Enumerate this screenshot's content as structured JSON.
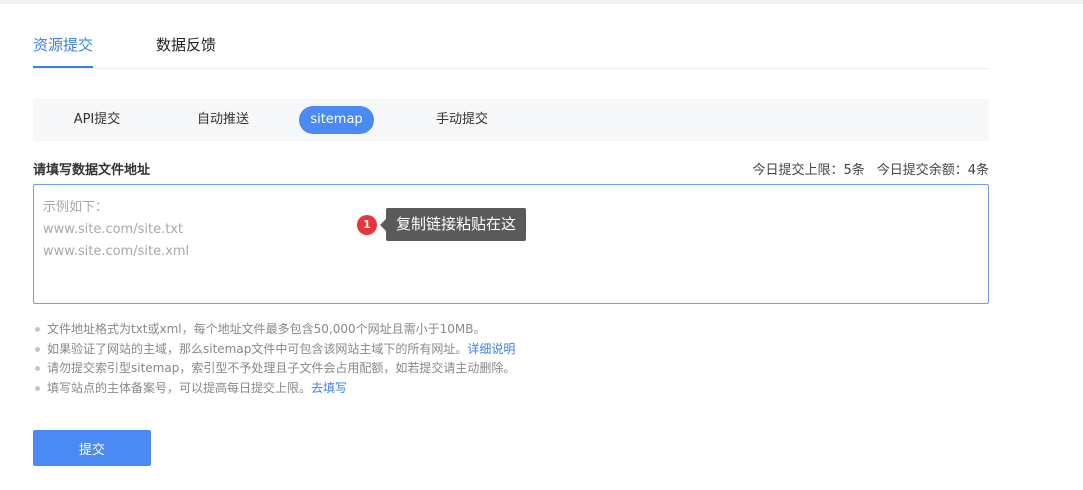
{
  "tabs": [
    {
      "label": "资源提交",
      "active": true
    },
    {
      "label": "数据反馈",
      "active": false
    }
  ],
  "subtabs": [
    {
      "label": "API提交",
      "active": false
    },
    {
      "label": "自动推送",
      "active": false
    },
    {
      "label": "sitemap",
      "active": true
    },
    {
      "label": "手动提交",
      "active": false
    }
  ],
  "form": {
    "label": "请填写数据文件地址",
    "quota_limit": "今日提交上限：5条",
    "quota_remaining": "今日提交余额：4条",
    "placeholder": "示例如下：\nwww.site.com/site.txt\nwww.site.com/site.xml",
    "value": ""
  },
  "hint": {
    "badge": "1",
    "text": "复制链接粘贴在这"
  },
  "notes": [
    {
      "text": "文件地址格式为txt或xml，每个地址文件最多包含50,000个网址且需小于10MB。",
      "link": ""
    },
    {
      "text": "如果验证了网站的主域，那么sitemap文件中可包含该网站主域下的所有网址。",
      "link": "详细说明"
    },
    {
      "text": "请勿提交索引型sitemap，索引型不予处理且子文件会占用配额，如若提交请主动删除。",
      "link": ""
    },
    {
      "text": "填写站点的主体备案号，可以提高每日提交上限。",
      "link": "去填写"
    }
  ],
  "submit_label": "提交",
  "colors": {
    "accent": "#3a7ff0",
    "button": "#4a8af4",
    "badge": "#e8353b",
    "tooltip": "#5a5a5a"
  }
}
